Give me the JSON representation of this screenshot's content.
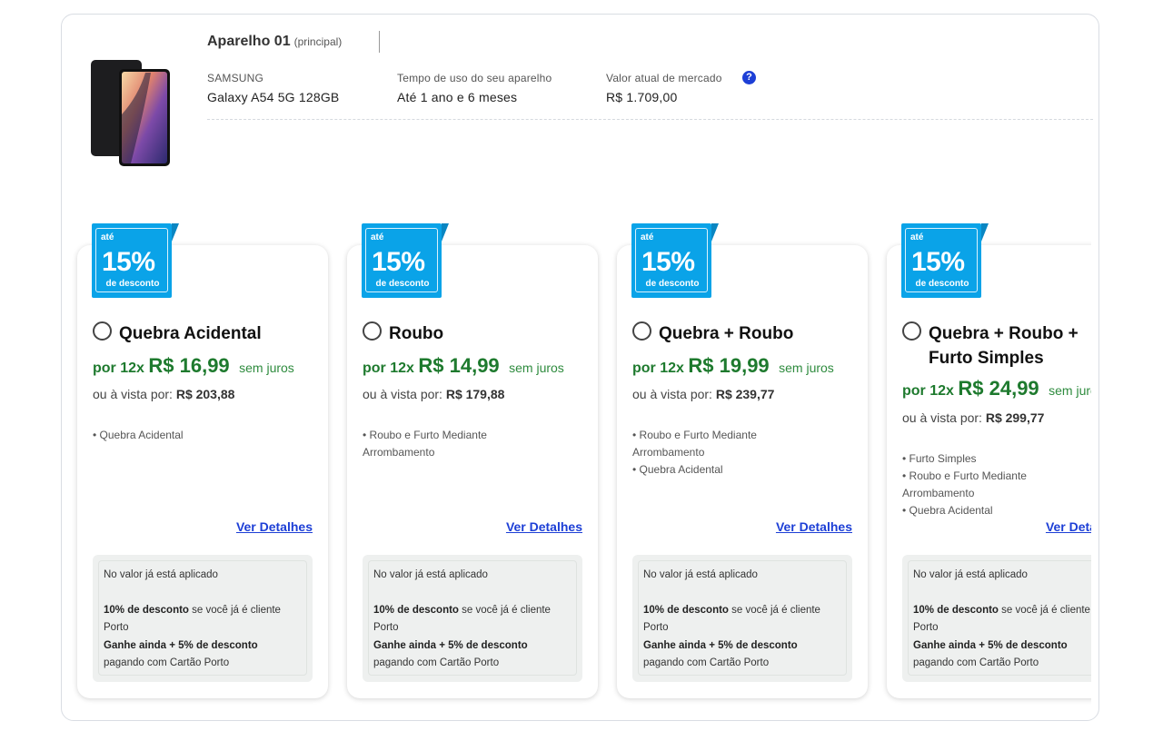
{
  "device": {
    "name": "Aparelho 01",
    "tag": "(principal)",
    "brand_label": "SAMSUNG",
    "model": "Galaxy A54 5G 128GB",
    "usage_label": "Tempo de uso do seu aparelho",
    "usage_value": "Até 1 ano e 6 meses",
    "market_label": "Valor atual de mercado",
    "market_value": "R$ 1.709,00",
    "help_icon": "?"
  },
  "badge": {
    "ate": "até",
    "pct": "15%",
    "desc": "de desconto"
  },
  "common": {
    "por": "por 12x",
    "sem_juros": "sem juros",
    "vista_label": "ou à vista por:",
    "details": "Ver Detalhes",
    "promo_line1": "No valor já está aplicado",
    "promo_bold1": "10% de desconto",
    "promo_text1": " se você já é cliente Porto",
    "promo_bold2": "Ganhe ainda + 5% de desconto",
    "promo_text2": "pagando com Cartão Porto"
  },
  "plans": [
    {
      "title": "Quebra Acidental",
      "installment": "R$ 16,99",
      "cash": "R$ 203,88",
      "covers": [
        "• Quebra Acidental"
      ]
    },
    {
      "title": "Roubo",
      "installment": "R$ 14,99",
      "cash": "R$ 179,88",
      "covers": [
        "• Roubo e Furto Mediante Arrombamento"
      ]
    },
    {
      "title": "Quebra + Roubo",
      "installment": "R$ 19,99",
      "cash": "R$ 239,77",
      "covers": [
        "• Roubo e Furto Mediante Arrombamento",
        "• Quebra Acidental"
      ]
    },
    {
      "title": "Quebra + Roubo + Furto Simples",
      "installment": "R$ 24,99",
      "cash": "R$ 299,77",
      "covers": [
        "• Furto Simples",
        "• Roubo e Furto Mediante Arrombamento",
        "• Quebra Acidental"
      ]
    }
  ],
  "colors": {
    "accent_blue": "#1d3fd6",
    "badge_blue": "#0aa3e8",
    "price_green": "#1e7a2e"
  }
}
